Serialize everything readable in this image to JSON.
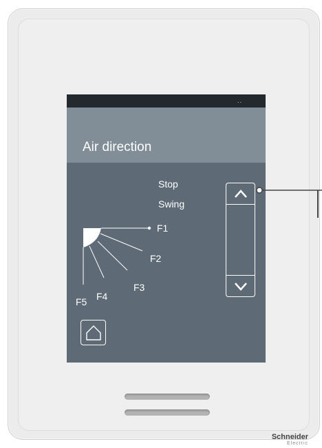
{
  "status": {
    "text": ".."
  },
  "screen": {
    "title": "Air direction",
    "options": [
      "Stop",
      "Swing"
    ],
    "fan_positions": [
      "F1",
      "F2",
      "F3",
      "F4",
      "F5"
    ],
    "selected_position": "F1"
  },
  "brand": {
    "name": "Schneider",
    "sub": "Electric"
  },
  "colors": {
    "screen_bg": "#5e6b77",
    "title_bar": "#818e98",
    "status_bar": "#24292e",
    "device_body": "#ececec"
  }
}
